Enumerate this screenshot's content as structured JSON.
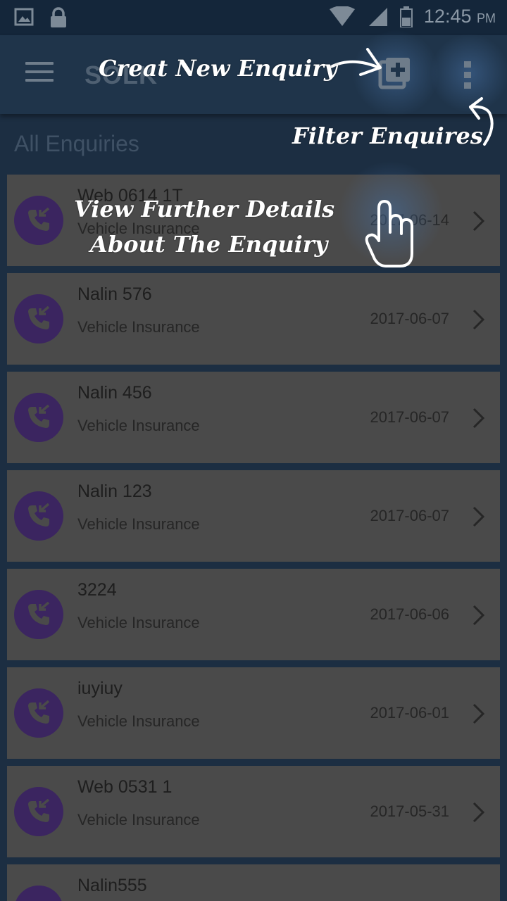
{
  "status_bar": {
    "time": "12:45",
    "ampm": "PM"
  },
  "toolbar": {
    "app_title": "SOLK"
  },
  "list_header": "All Enquiries",
  "enquiries": [
    {
      "title": "Web 0614 1T",
      "type": "Vehicle Insurance",
      "date": "2017-06-14"
    },
    {
      "title": "Nalin 576",
      "type": "Vehicle Insurance",
      "date": "2017-06-07"
    },
    {
      "title": "Nalin 456",
      "type": "Vehicle Insurance",
      "date": "2017-06-07"
    },
    {
      "title": "Nalin 123",
      "type": "Vehicle Insurance",
      "date": "2017-06-07"
    },
    {
      "title": "3224",
      "type": "Vehicle Insurance",
      "date": "2017-06-06"
    },
    {
      "title": "iuyiuy",
      "type": "Vehicle Insurance",
      "date": "2017-06-01"
    },
    {
      "title": "Web 0531 1",
      "type": "Vehicle Insurance",
      "date": "2017-05-31"
    },
    {
      "title": "Nalin555",
      "type": "",
      "date": ""
    }
  ],
  "annotations": {
    "create": "Creat New Enquiry",
    "filter": "Filter Enquires",
    "details_line1": "View Further Details",
    "details_line2": "About The Enquiry"
  },
  "icons": {
    "avatar": "phone-callback-icon",
    "add": "add-box-icon",
    "more": "more-vert-icon",
    "menu": "hamburger-menu-icon",
    "hand": "pointing-hand-icon"
  },
  "colors": {
    "avatar_bg": "#3b2560",
    "row_bg": "#4a4a4a",
    "toolbar_bg": "#1f344a"
  }
}
